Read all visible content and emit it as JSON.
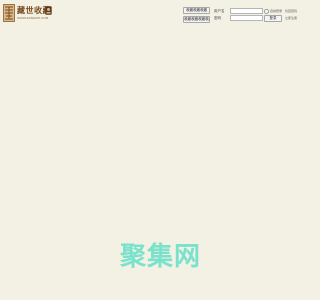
{
  "logo": {
    "title": "藏世收藏",
    "subtitle": "WWW.ZANGSHI.COM"
  },
  "buttons": {
    "primary": "收藏收藏收藏",
    "secondary": "收藏收藏收藏收藏收藏"
  },
  "login": {
    "username_label": "用户名",
    "password_label": "密码",
    "remember_label": "自动登录",
    "submit_label": "登录",
    "forgot_link": "找回密码",
    "register_link": "立即注册"
  },
  "watermark": "聚集网",
  "colors": {
    "background": "#f2f1e3",
    "watermark": "#6ee0c9",
    "logo": "#7a4a1e"
  }
}
